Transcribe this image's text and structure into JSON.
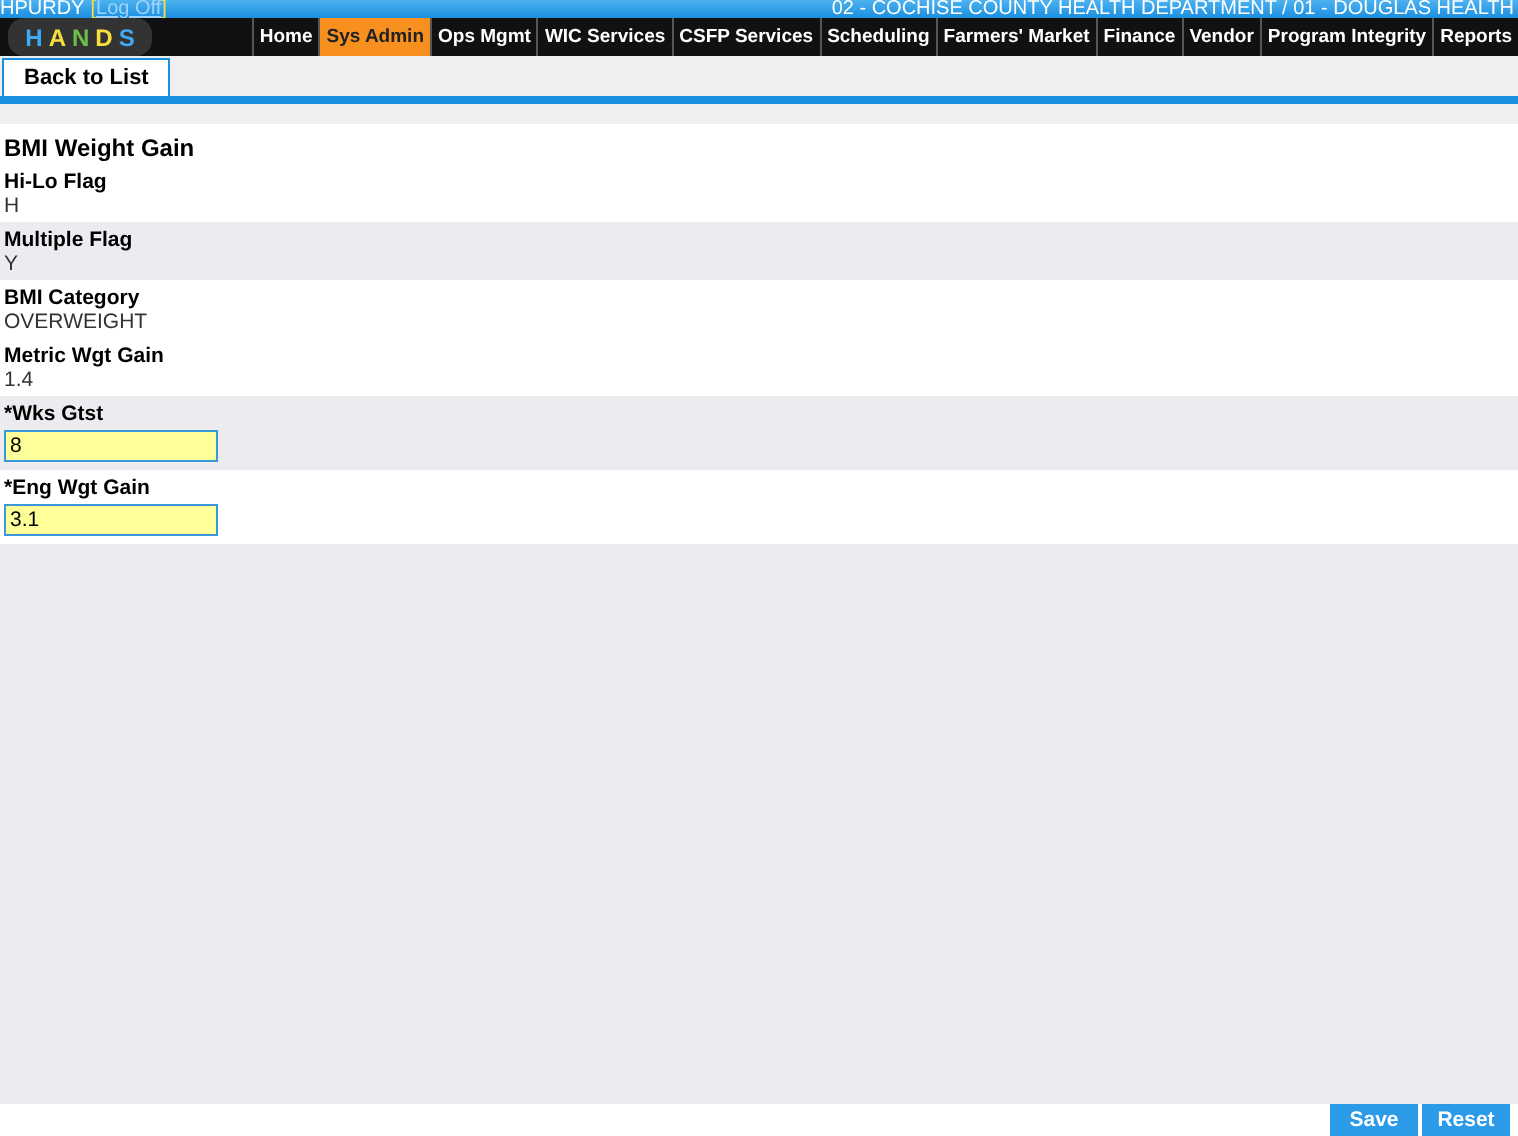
{
  "header": {
    "user": "HPURDY",
    "bracket_open": "[",
    "logoff_link": "Log Off",
    "bracket_close": "]",
    "location": "02 - COCHISE COUNTY HEALTH DEPARTMENT / 01 - DOUGLAS HEALTH"
  },
  "logo": {
    "letters": [
      {
        "text": "H",
        "color": "#3fa9f5"
      },
      {
        "text": "A",
        "color": "#f7e03c"
      },
      {
        "text": "N",
        "color": "#6cc04a"
      },
      {
        "text": "D",
        "color": "#f7e03c"
      },
      {
        "text": "S",
        "color": "#3fa9f5"
      }
    ]
  },
  "nav": [
    {
      "label": "Home",
      "selected": false
    },
    {
      "label": "Sys Admin",
      "selected": true
    },
    {
      "label": "Ops Mgmt",
      "selected": false
    },
    {
      "label": "WIC Services",
      "selected": false
    },
    {
      "label": "CSFP Services",
      "selected": false
    },
    {
      "label": "Scheduling",
      "selected": false
    },
    {
      "label": "Farmers' Market",
      "selected": false
    },
    {
      "label": "Finance",
      "selected": false
    },
    {
      "label": "Vendor",
      "selected": false
    },
    {
      "label": "Program Integrity",
      "selected": false
    },
    {
      "label": "Reports",
      "selected": false
    }
  ],
  "tabs": [
    {
      "label": "Back to List",
      "selected": true
    }
  ],
  "form": {
    "title": "BMI Weight Gain",
    "fields": [
      {
        "kind": "text",
        "label": "Hi-Lo Flag",
        "value": "H",
        "shaded": false
      },
      {
        "kind": "text",
        "label": "Multiple Flag",
        "value": "Y",
        "shaded": true
      },
      {
        "kind": "text",
        "label": "BMI Category",
        "value": "OVERWEIGHT",
        "shaded": false
      },
      {
        "kind": "text",
        "label": "Metric Wgt Gain",
        "value": "1.4",
        "shaded": false
      },
      {
        "kind": "input",
        "label": "*Wks Gtst",
        "value": "8",
        "shaded": true
      },
      {
        "kind": "input",
        "label": "*Eng Wgt Gain",
        "value": "3.1",
        "shaded": false
      }
    ]
  },
  "buttons": [
    "Save",
    "Reset"
  ]
}
